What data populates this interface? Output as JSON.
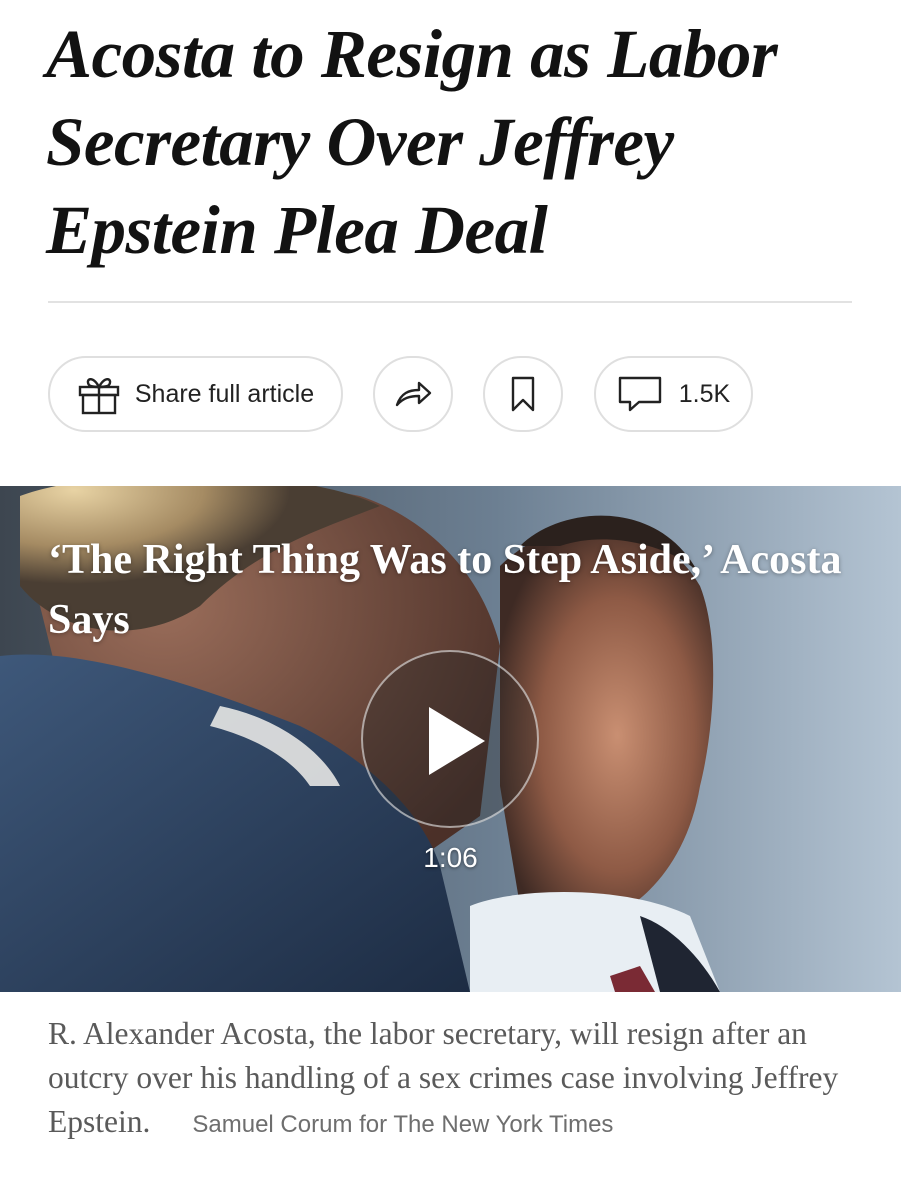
{
  "article": {
    "headline": "Acosta to Resign as Labor Secretary Over Jeffrey Epstein Plea Deal"
  },
  "toolbar": {
    "share_full_label": "Share full article",
    "comments_count": "1.5K"
  },
  "video": {
    "title": "‘The Right Thing Was to Step Aside,’ Acosta Says",
    "duration": "1:06"
  },
  "caption": {
    "text": "R. Alexander Acosta, the labor secretary, will resign after an outcry over his handling of a sex crimes case involving Jeffrey Epstein.",
    "credit": "Samuel Corum for The New York Times"
  },
  "icons": {
    "gift": "gift-icon",
    "share": "share-arrow-icon",
    "bookmark": "bookmark-icon",
    "comment": "comment-icon",
    "play": "play-icon"
  }
}
